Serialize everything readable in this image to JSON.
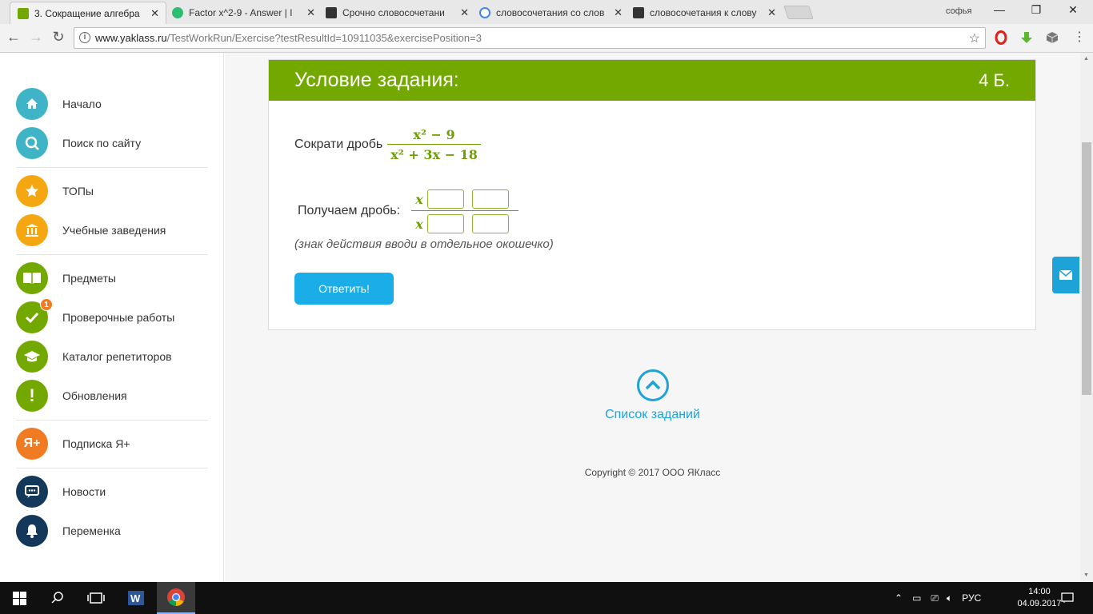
{
  "browser": {
    "tabs": [
      {
        "label": "3. Сокращение алгебра",
        "favicon_color": "#73a800",
        "active": true
      },
      {
        "label": "Factor x^2-9 - Answer | I",
        "favicon_color": "#2bbd72",
        "active": false
      },
      {
        "label": "Срочно словосочетани",
        "favicon_color": "#333333",
        "active": false
      },
      {
        "label": "словосочетания со слов",
        "favicon_color": "#4285f4",
        "active": false
      },
      {
        "label": "словосочетания к слову",
        "favicon_color": "#333333",
        "active": false
      }
    ],
    "user": "софья",
    "url_host": "www.yaklass.ru",
    "url_path": "/TestWorkRun/Exercise?testResultId=10911035&exercisePosition=3"
  },
  "sidebar": {
    "items": [
      {
        "label": "Начало",
        "color": "#3fb4c6",
        "icon": "home-icon"
      },
      {
        "label": "Поиск по сайту",
        "color": "#3fb4c6",
        "icon": "search-icon"
      },
      {
        "label": "ТОПы",
        "color": "#f5a711",
        "icon": "star-icon"
      },
      {
        "label": "Учебные заведения",
        "color": "#f5a711",
        "icon": "building-icon"
      },
      {
        "label": "Предметы",
        "color": "#73a800",
        "icon": "book-icon"
      },
      {
        "label": "Проверочные работы",
        "color": "#73a800",
        "icon": "check-icon",
        "badge": "1"
      },
      {
        "label": "Каталог репетиторов",
        "color": "#73a800",
        "icon": "graduation-cap-icon"
      },
      {
        "label": "Обновления",
        "color": "#73a800",
        "icon": "exclamation-icon"
      },
      {
        "label": "Подписка Я+",
        "color": "#f07b22",
        "icon": "ya-plus-icon",
        "icon_text": "Я+"
      },
      {
        "label": "Новости",
        "color": "#13385a",
        "icon": "chat-icon"
      },
      {
        "label": "Переменка",
        "color": "#13385a",
        "icon": "bell-icon"
      }
    ]
  },
  "task": {
    "title": "Условие задания:",
    "points": "4 Б.",
    "prompt": "Сократи дробь",
    "fraction_numerator": "x² − 9",
    "fraction_denominator": "x² + 3x − 18",
    "answer_prompt": "Получаем дробь:",
    "answer_var": "x",
    "hint": "(знак действия вводи в отдельное окошечко)",
    "submit_label": "Ответить!"
  },
  "footer": {
    "tasks_link": "Список заданий",
    "copyright": "Copyright © 2017 ООО ЯКласс"
  },
  "taskbar": {
    "lang": "РУС",
    "time": "14:00",
    "date": "04.09.2017"
  }
}
